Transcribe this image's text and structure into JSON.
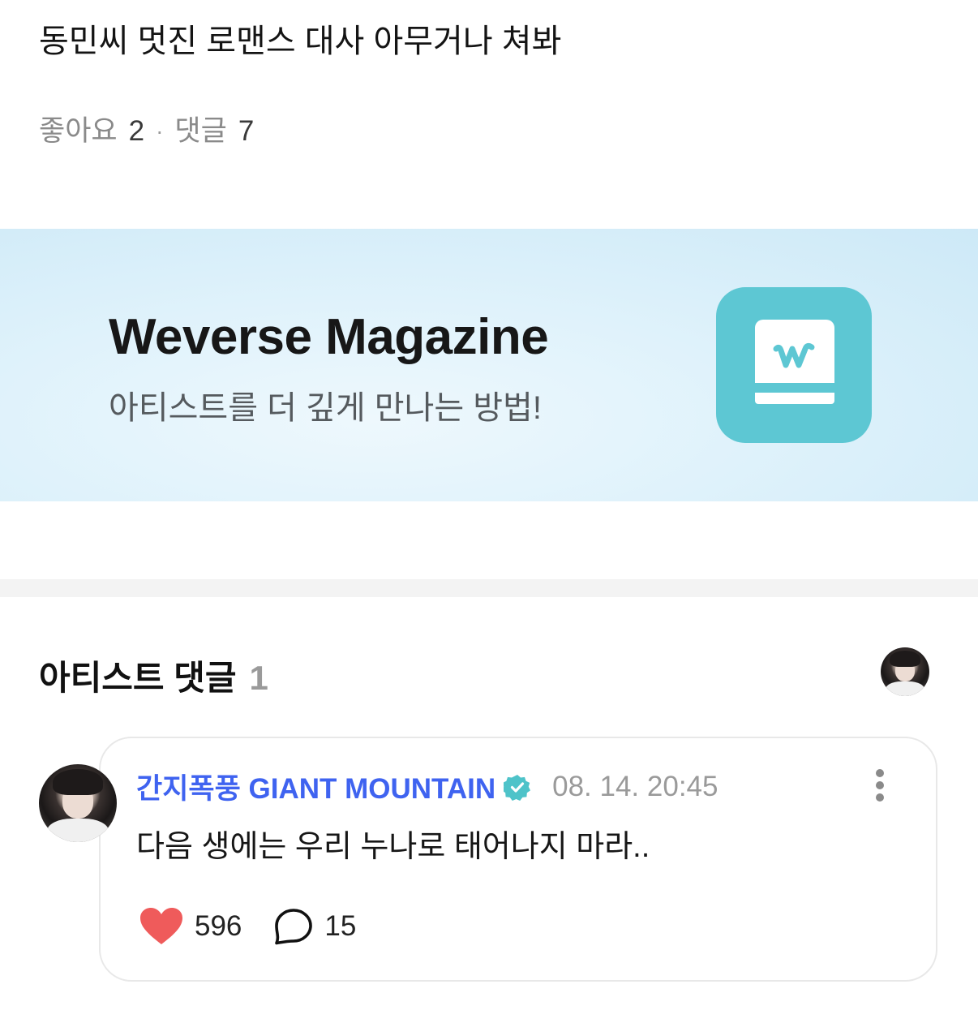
{
  "post": {
    "title": "동민씨 멋진 로맨스 대사 아무거나 쳐봐",
    "likes_label": "좋아요",
    "likes_count": "2",
    "separator": "·",
    "comments_label": "댓글",
    "comments_count": "7"
  },
  "banner": {
    "title": "Weverse Magazine",
    "subtitle": "아티스트를 더 깊게 만나는 방법!",
    "icon": "weverse-magazine-book-icon",
    "icon_color": "#5dc7d3"
  },
  "artist_comments": {
    "heading": "아티스트 댓글",
    "count": "1",
    "comment": {
      "author": "간지폭풍 GIANT MOUNTAIN",
      "verified": true,
      "timestamp": "08. 14. 20:45",
      "text": "다음 생에는 우리 누나로 태어나지 마라..",
      "likes": "596",
      "replies": "15"
    }
  },
  "colors": {
    "author_blue": "#3f63f0",
    "verified_teal": "#4ec3c9",
    "heart_red": "#ef5b5b"
  }
}
